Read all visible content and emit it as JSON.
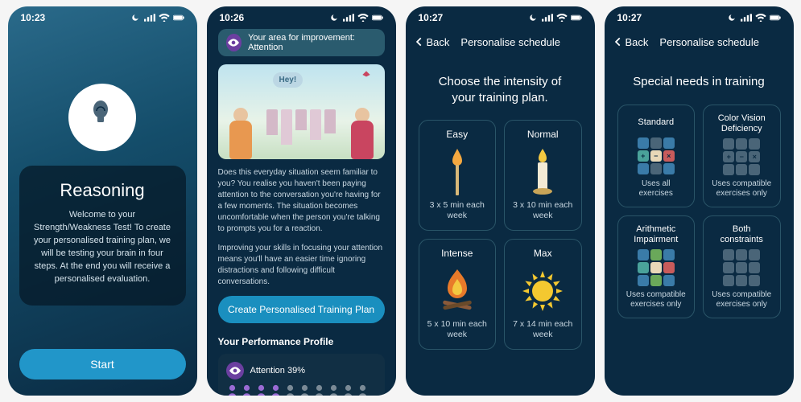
{
  "status": {
    "s1_time": "10:23",
    "s2_time": "10:26",
    "s3_time": "10:27",
    "s4_time": "10:27"
  },
  "s1": {
    "title": "Reasoning",
    "body": "Welcome to your Strength/Weakness Test! To create your personalised training plan, we will be testing your brain in four steps. At the end you will receive a personalised evaluation.",
    "button": "Start"
  },
  "s2": {
    "banner": "Your area for improvement: Attention",
    "speech": "Hey!",
    "para1": "Does this everyday situation seem familiar to you? You realise you haven't been paying attention to the conversation you're having for a few moments. The situation becomes uncomfortable when the person you're talking to prompts you for a reaction.",
    "para2": "Improving your skills in focusing your attention means you'll have an easier time ignoring distractions and following difficult conversations.",
    "cta": "Create Personalised Training Plan",
    "profile_label": "Your Performance Profile",
    "attention_label": "Attention 39%",
    "attention_filled": 4,
    "attention_total": 10
  },
  "s3": {
    "back": "Back",
    "nav_title": "Personalise schedule",
    "heading": "Choose the intensity of your training plan.",
    "cards": [
      {
        "title": "Easy",
        "sub": "3 x 5 min each week"
      },
      {
        "title": "Normal",
        "sub": "3 x 10 min each week"
      },
      {
        "title": "Intense",
        "sub": "5 x 10 min each week"
      },
      {
        "title": "Max",
        "sub": "7 x 14 min each week"
      }
    ]
  },
  "s4": {
    "back": "Back",
    "nav_title": "Personalise schedule",
    "heading": "Special needs in training",
    "cards": [
      {
        "title": "Standard",
        "sub": "Uses all exercises"
      },
      {
        "title": "Color Vision Deficiency",
        "sub": "Uses compatible exercises only"
      },
      {
        "title": "Arithmetic Impairment",
        "sub": "Uses compatible exercises only"
      },
      {
        "title": "Both constraints",
        "sub": "Uses compatible exercises only"
      }
    ]
  },
  "colors": {
    "tile_blue": "#3a7ba8",
    "tile_teal": "#4aa29a",
    "tile_cream": "#e8d8b8",
    "tile_red": "#c95b5b",
    "tile_gray": "#4a6578",
    "tile_green": "#6aa85a"
  }
}
